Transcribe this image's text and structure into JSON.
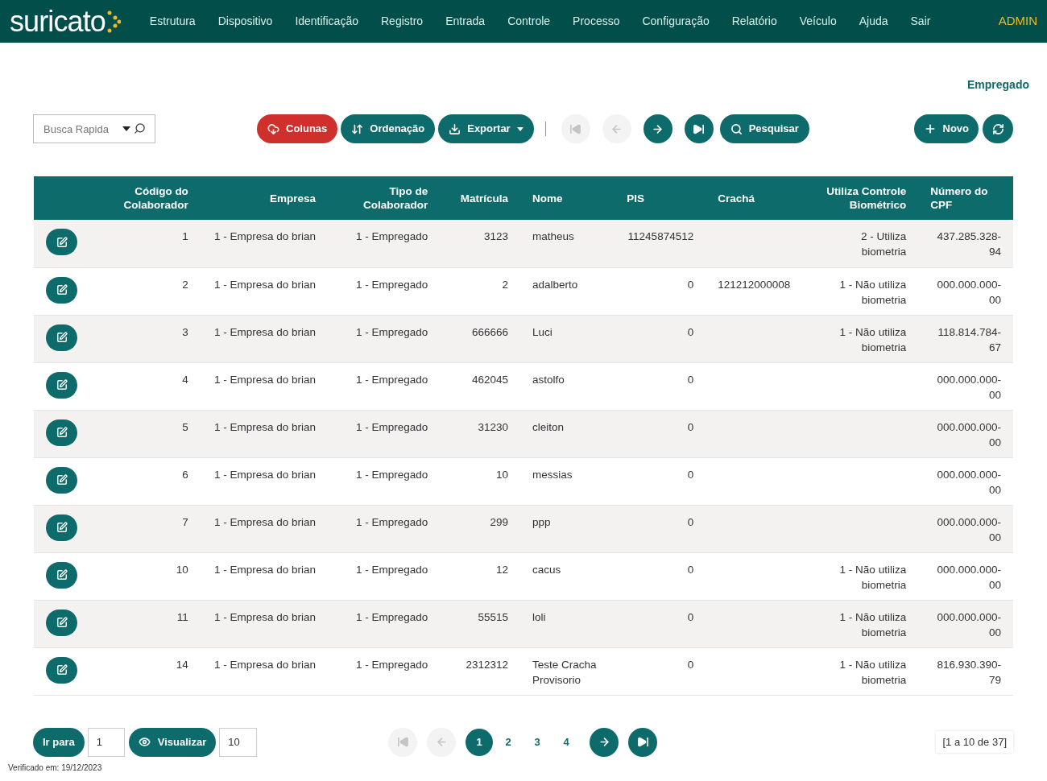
{
  "nav": {
    "logo": "suricato",
    "items": [
      "Estrutura",
      "Dispositivo",
      "Identificação",
      "Registro",
      "Entrada",
      "Controle",
      "Processo",
      "Configuração",
      "Relatório",
      "Veículo",
      "Ajuda",
      "Sair"
    ],
    "user": "ADMIN"
  },
  "page_title": "Empregado",
  "toolbar": {
    "search": {
      "placeholder": "Busca Rapida"
    },
    "buttons": [
      {
        "kind": "columns",
        "label": "Colunas"
      },
      {
        "kind": "sort",
        "label": "Ordenação"
      },
      {
        "kind": "export",
        "label": "Exportar"
      }
    ],
    "nav_buttons": [
      {
        "kind": "first",
        "disabled": true
      },
      {
        "kind": "prev",
        "disabled": true
      },
      {
        "kind": "next",
        "disabled": false
      },
      {
        "kind": "last",
        "disabled": false
      }
    ],
    "search_button": "Pesquisar",
    "new_button": "Novo"
  },
  "table": {
    "columns": [
      "Código do Colaborador",
      "Empresa",
      "Tipo de Colaborador",
      "Matrícula",
      "Nome",
      "PIS",
      "Crachá",
      "Utiliza Controle Biométrico",
      "Número do CPF"
    ],
    "rows": [
      [
        "1",
        "1 - Empresa do brian",
        "1 - Empregado",
        "3123",
        "matheus",
        "11245874512",
        "",
        "2 - Utiliza biometria",
        "437.285.328-94"
      ],
      [
        "2",
        "1 - Empresa do brian",
        "1 - Empregado",
        "2",
        "adalberto",
        "0",
        "121212000008",
        "1 - Não utiliza biometria",
        "000.000.000-00"
      ],
      [
        "3",
        "1 - Empresa do brian",
        "1 - Empregado",
        "666666",
        "Luci",
        "0",
        "",
        "1 - Não utiliza biometria",
        "118.814.784-67"
      ],
      [
        "4",
        "1 - Empresa do brian",
        "1 - Empregado",
        "462045",
        "astolfo",
        "0",
        "",
        "",
        "000.000.000-00"
      ],
      [
        "5",
        "1 - Empresa do brian",
        "1 - Empregado",
        "31230",
        "cleiton",
        "0",
        "",
        "",
        "000.000.000-00"
      ],
      [
        "6",
        "1 - Empresa do brian",
        "1 - Empregado",
        "10",
        "messias",
        "0",
        "",
        "",
        "000.000.000-00"
      ],
      [
        "7",
        "1 - Empresa do brian",
        "1 - Empregado",
        "299",
        "ppp",
        "0",
        "",
        "",
        "000.000.000-00"
      ],
      [
        "10",
        "1 - Empresa do brian",
        "1 - Empregado",
        "12",
        "cacus",
        "0",
        "",
        "1 - Não utiliza biometria",
        "000.000.000-00"
      ],
      [
        "11",
        "1 - Empresa do brian",
        "1 - Empregado",
        "55515",
        "loli",
        "0",
        "",
        "1 - Não utiliza biometria",
        "000.000.000-00"
      ],
      [
        "14",
        "1 - Empresa do brian",
        "1 - Empregado",
        "2312312",
        "Teste Cracha Provisorio",
        "0",
        "",
        "1 - Não utiliza biometria",
        "816.930.390-79"
      ]
    ]
  },
  "footer": {
    "goto_label": "Ir para",
    "goto_value": "1",
    "view_label": "Visualizar",
    "view_value": "10",
    "pages": [
      {
        "label": "1",
        "selected": true
      },
      {
        "label": "2",
        "selected": false
      },
      {
        "label": "3",
        "selected": false
      },
      {
        "label": "4",
        "selected": false
      }
    ],
    "range": "[1 a 10 de 37]",
    "verified": "Verificado em: 19/12/2023"
  }
}
